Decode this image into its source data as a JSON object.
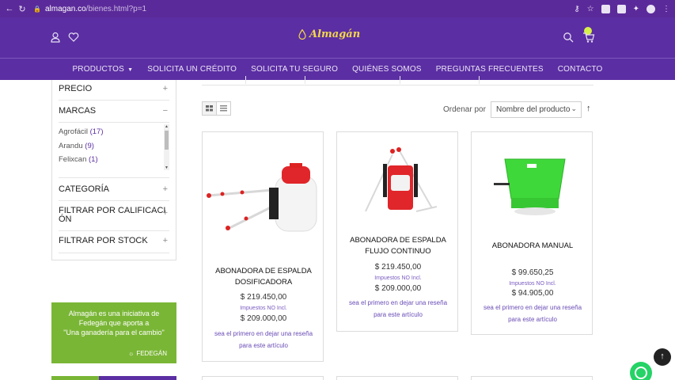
{
  "browser": {
    "url_host": "almagan.co",
    "url_path": "/bienes.html?p=1"
  },
  "header": {
    "logo_text": "Almagán",
    "brand_color": "#5b2ea3",
    "logo_color": "#f3d64a",
    "icons": [
      "user-icon",
      "heart-icon",
      "search-icon",
      "cart-icon"
    ]
  },
  "nav": {
    "items": [
      "PRODUCTOS",
      "SOLICITA UN CRÉDITO",
      "SOLICITA TU SEGURO",
      "QUIÉNES SOMOS",
      "PREGUNTAS FRECUENTES",
      "CONTACTO"
    ]
  },
  "sidebar": {
    "precio": "PRECIO",
    "marcas": "MARCAS",
    "brands": [
      {
        "name": "Agrofácil",
        "count": "(17)"
      },
      {
        "name": "Arandu",
        "count": "(9)"
      },
      {
        "name": "Felixcan",
        "count": "(1)"
      }
    ],
    "categoria": "CATEGORÍA",
    "calificacion_1": "FILTRAR POR CALIFICACI",
    "calificacion_2": "ÓN",
    "stock": "FILTRAR POR STOCK",
    "plus": "+",
    "minus": "−"
  },
  "promo": {
    "line1": "Almagán es una iniciativa de",
    "line2": "Fedegán que aporta a",
    "line3": "\"Una ganadería para el cambio\"",
    "fedegan": "FEDEGÁN",
    "color": "#7ab636"
  },
  "toolbar": {
    "sort_label": "Ordenar por",
    "sort_value": "Nombre del producto",
    "sort_dir": "↑"
  },
  "products": [
    {
      "name_line1": "ABONADORA DE ESPALDA",
      "name_line2": "DOSIFICADORA",
      "price": "$ 219.450,00",
      "tax": "Impuestos NO Incl.",
      "price_no_tax": "$ 209.000,00",
      "review_line1": "sea el primero en dejar una reseña",
      "review_line2": "para este artículo"
    },
    {
      "name_line1": "ABONADORA DE ESPALDA",
      "name_line2": "FLUJO CONTINUO",
      "price": "$ 219.450,00",
      "tax": "Impuestos NO Incl.",
      "price_no_tax": "$ 209.000,00",
      "review_line1": "sea el primero en dejar una reseña",
      "review_line2": "para este artículo"
    },
    {
      "name_line1": "ABONADORA MANUAL",
      "name_line2": "",
      "price": "$ 99.650,25",
      "tax": "Impuestos NO Incl.",
      "price_no_tax": "$ 94.905,00",
      "review_line1": "sea el primero en dejar una reseña",
      "review_line2": "para este artículo"
    }
  ]
}
